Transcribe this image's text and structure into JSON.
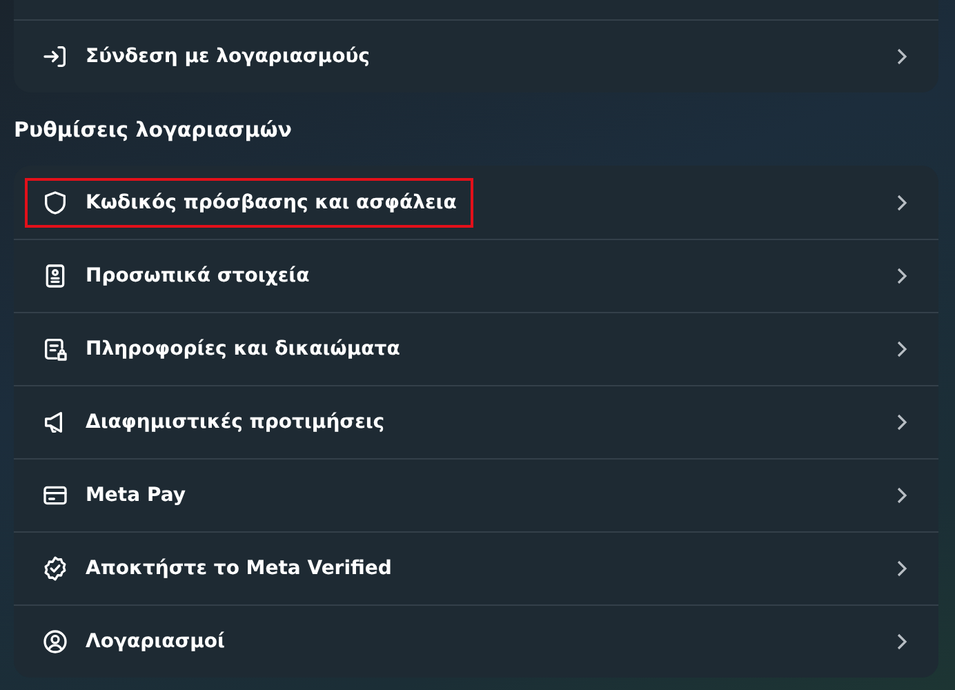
{
  "top_section": {
    "items": [
      {
        "label": "Σύνδεση με λογαριασμούς",
        "kind": "login",
        "highlighted": false
      }
    ]
  },
  "account_settings": {
    "heading": "Ρυθμίσεις λογαριασμών",
    "items": [
      {
        "label": "Κωδικός πρόσβασης και ασφάλεια",
        "kind": "shield",
        "highlighted": true
      },
      {
        "label": "Προσωπικά στοιχεία",
        "kind": "idcard",
        "highlighted": false
      },
      {
        "label": "Πληροφορίες και δικαιώματα",
        "kind": "doclock",
        "highlighted": false
      },
      {
        "label": "Διαφημιστικές προτιμήσεις",
        "kind": "megaphone",
        "highlighted": false
      },
      {
        "label": "Meta Pay",
        "kind": "card",
        "highlighted": false
      },
      {
        "label": "Αποκτήστε το Meta Verified",
        "kind": "badge",
        "highlighted": false
      },
      {
        "label": "Λογαριασμοί",
        "kind": "person",
        "highlighted": false
      }
    ]
  }
}
